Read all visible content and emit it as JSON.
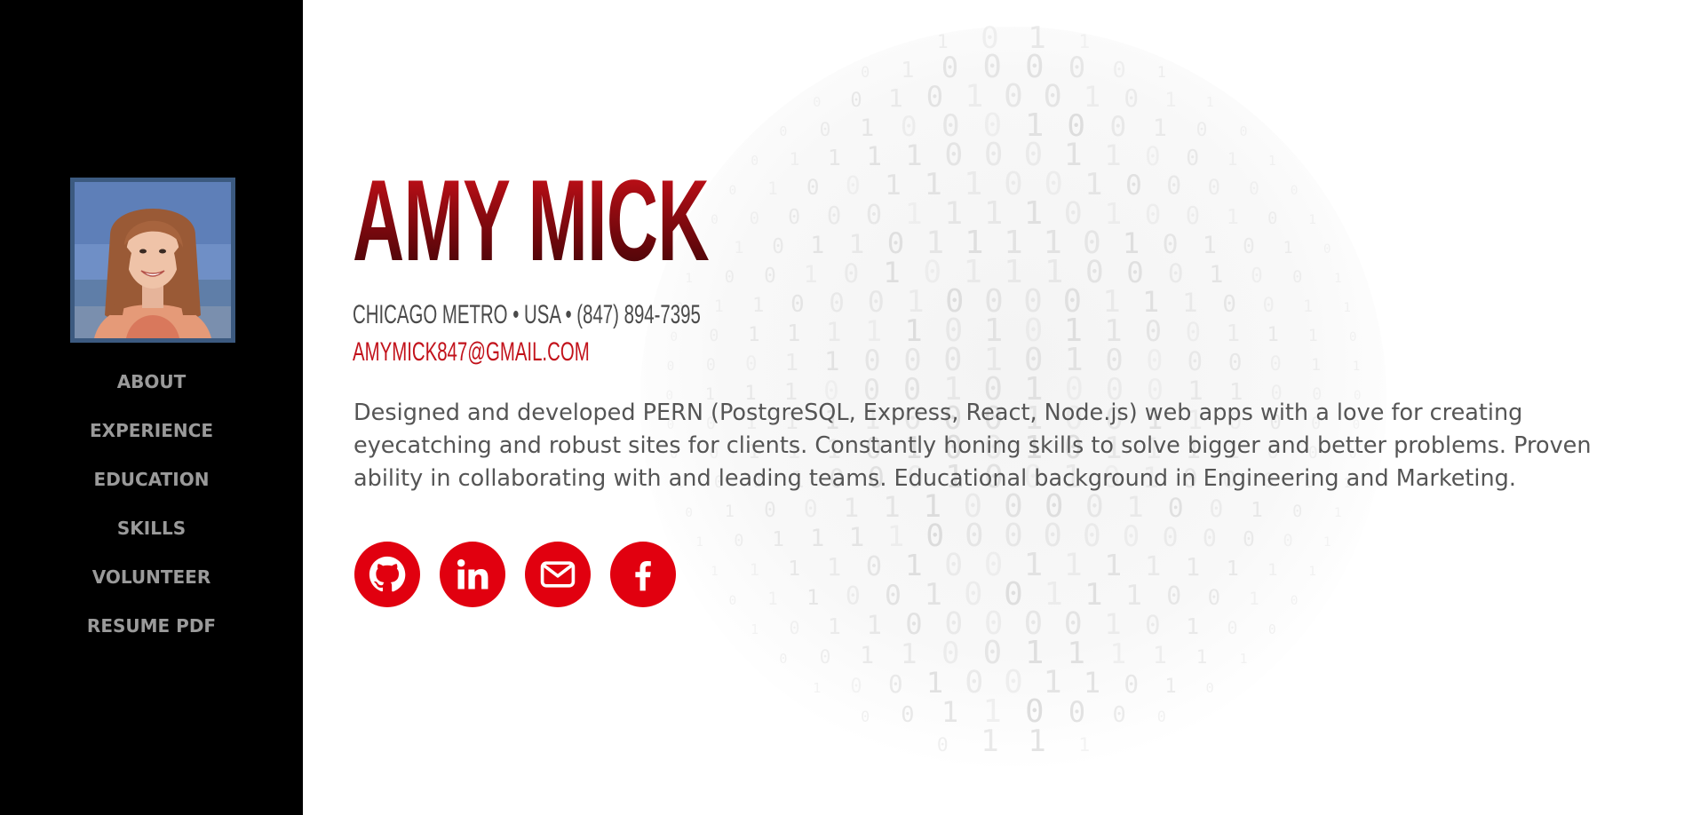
{
  "sidebar": {
    "photo_alt": "Amy Mick",
    "nav": [
      {
        "label": "ABOUT"
      },
      {
        "label": "EXPERIENCE"
      },
      {
        "label": "EDUCATION"
      },
      {
        "label": "SKILLS"
      },
      {
        "label": "VOLUNTEER"
      },
      {
        "label": "RESUME PDF"
      }
    ]
  },
  "hero": {
    "name": "AMY MICK",
    "contact_line": "CHICAGO METRO • USA • (847) 894-7395",
    "email": "AMYMICK847@GMAIL.COM",
    "bio": "Designed and developed PERN (PostgreSQL, Express, React, Node.js) web apps with a love for creating eyecatching and robust sites for clients. Constantly honing skills to solve bigger and better problems. Proven ability in collaborating with and leading teams. Educational background in Engineering and Marketing."
  },
  "socials": [
    {
      "icon": "github-icon"
    },
    {
      "icon": "linkedin-icon"
    },
    {
      "icon": "email-icon"
    },
    {
      "icon": "facebook-icon"
    }
  ],
  "colors": {
    "sidebar_bg": "#000000",
    "nav_text": "#9a9a9a",
    "accent_red": "#e1000f",
    "name_dark_red": "#8b0a10",
    "email_red": "#c2121b",
    "body_text": "#555555"
  }
}
